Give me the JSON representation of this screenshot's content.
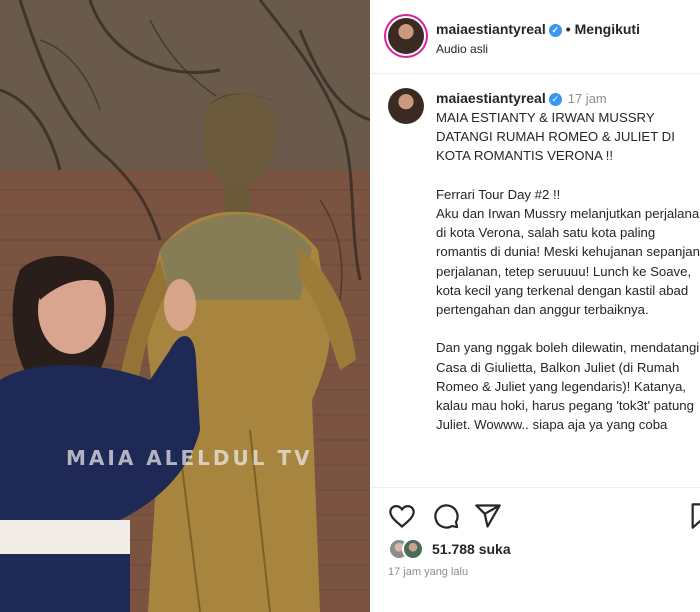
{
  "media": {
    "watermark": "MAIA ALELDUL TV"
  },
  "header": {
    "username": "maiaestiantyreal",
    "separator": "•",
    "follow_label": "Mengikuti",
    "audio": "Audio asli"
  },
  "caption": {
    "username": "maiaestiantyreal",
    "time": "17 jam",
    "text": "MAIA ESTIANTY & IRWAN MUSSRY DATANGI RUMAH ROMEO & JULIET DI KOTA ROMANTIS VERONA !!\n\nFerrari Tour Day #2 !!\nAku dan Irwan Mussry melanjutkan perjalanan di kota Verona, salah satu kota paling romantis di dunia! Meski kehujanan sepanjang perjalanan, tetep seruuuu! Lunch ke Soave, kota kecil yang terkenal dengan kastil abad pertengahan dan anggur terbaiknya.\n\nDan yang nggak boleh dilewatin, mendatangi Casa di Giulietta, Balkon Juliet (di Rumah Romeo & Juliet yang legendaris)! Katanya, kalau mau hoki, harus pegang 'tok3t' patung Juliet. Wowww.. siapa aja ya yang coba"
  },
  "actions": {
    "likes": "51.788 suka",
    "time_ago": "17 jam yang lalu"
  },
  "icons": [
    "heart-icon",
    "comment-icon",
    "share-icon",
    "verified-icon"
  ],
  "colors": {
    "verified": "#3897f0",
    "muted": "#8e8e8e",
    "text": "#262626",
    "statue": "#a7853f"
  }
}
